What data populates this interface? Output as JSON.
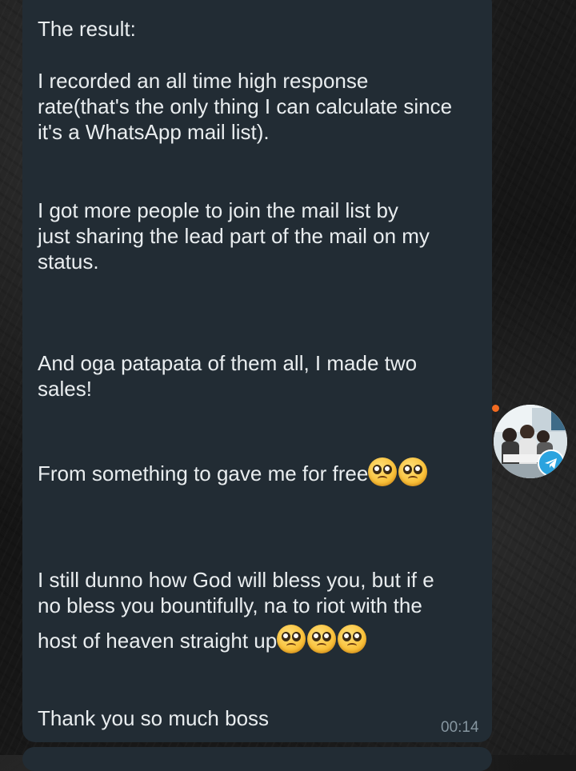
{
  "message": {
    "lines": [
      "The result:",
      "I recorded an all time high response",
      "rate(that's the only thing I can calculate since",
      "it's a WhatsApp mail list).",
      "I got more people to join the mail list by",
      "just sharing the lead part of the mail on my",
      "status.",
      "And oga patapata of them all, I made two",
      "sales!",
      "From something to gave me for free",
      "I still dunno how God will bless you, but if e",
      "no bless you bountifully, na to riot with the",
      "host of heaven straight up",
      "Thank you so much boss"
    ],
    "timestamp": "00:14"
  },
  "emojis": {
    "name": "pleading-face-icon",
    "line_free_count": 2,
    "line_heaven_count": 3
  },
  "avatar": {
    "badge_icon": "telegram-icon",
    "status_dot_color": "#f36b21"
  },
  "colors": {
    "bubble": "#222c34",
    "text": "#e9edef",
    "timestamp": "#8696a0"
  }
}
